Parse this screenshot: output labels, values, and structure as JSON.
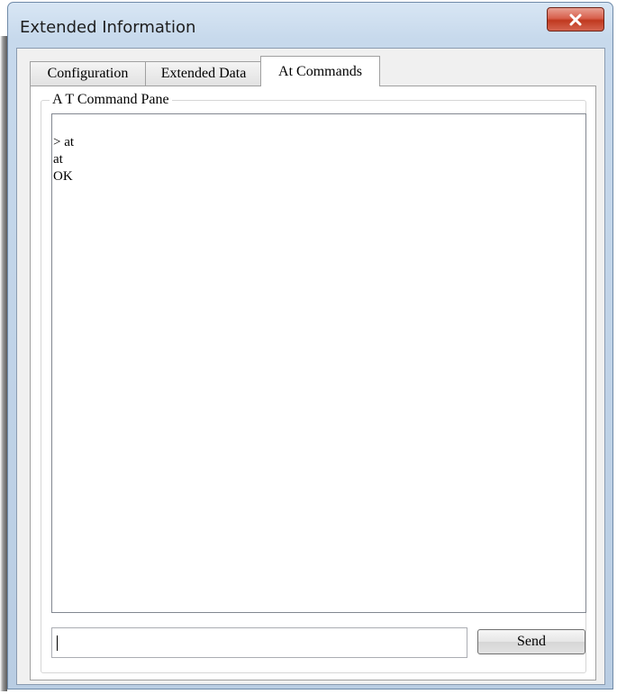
{
  "window": {
    "title": "Extended Information",
    "close_icon": "x-icon"
  },
  "tabs": [
    {
      "label": "Configuration",
      "active": false
    },
    {
      "label": "Extended Data",
      "active": false
    },
    {
      "label": "At Commands",
      "active": true
    }
  ],
  "pane": {
    "legend": "A T Command Pane",
    "output_lines": [
      "> at",
      "at",
      "OK"
    ],
    "input_value": "",
    "send_label": "Send"
  }
}
